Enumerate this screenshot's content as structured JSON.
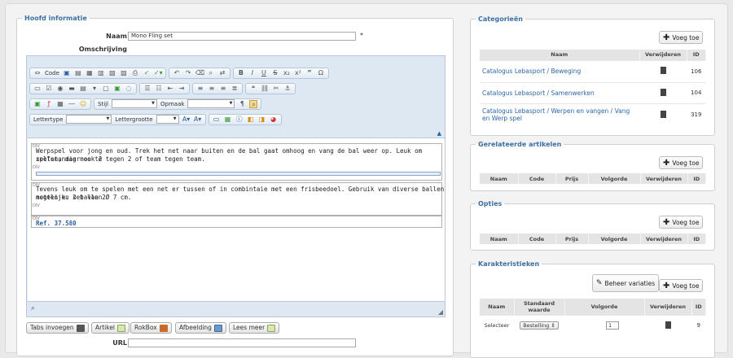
{
  "main": {
    "legend": "Hoofd informatie",
    "naam_label": "Naam",
    "naam_value": "Mono Fling set",
    "required_mark": "*",
    "omschrijving_label": "Omschrijving",
    "url_label": "URL"
  },
  "editor": {
    "code_label": "Code",
    "stijl_label": "Stijl",
    "opmaak_label": "Opmaak",
    "lettertype_label": "Lettertype",
    "lettergrootte_label": "Lettergrootte",
    "div_tag": "DIV",
    "para1": [
      "Werpspel voor jong en oud. Trek het net naar buiten en de bal gaat omhoog en vang de bal weer op. Leuk om zelfstandig mee te",
      "spelen, maar ook 2 tegen 2 of team tegen team."
    ],
    "para2": [
      "Tevens leuk om te spelen met een net er tussen of in combintaie met een frisbeedoel. Gebruik van diverse ballen mogelijk. set van 2",
      "netten en 2 ballen Ø 7 cm."
    ],
    "ref": "Ref. 37.580"
  },
  "plugin_buttons": [
    "Tabs invoegen",
    "Artikel",
    "RokBox",
    "Afbeelding",
    "Lees meer"
  ],
  "categories": {
    "legend": "Categorieën",
    "add_label": "Voeg toe",
    "col_naam": "Naam",
    "col_verwijderen": "Verwijderen",
    "col_id": "ID",
    "rows": [
      {
        "name": "Catalogus Lebasport / Beweging",
        "id": "106"
      },
      {
        "name": "Catalogus Lebasport / Samenwerken",
        "id": "104"
      },
      {
        "name": "Catalogus Lebasport / Werpen en vangen / Vang en Werp spel",
        "id": "319"
      }
    ]
  },
  "related": {
    "legend": "Gerelateerde artikelen",
    "add_label": "Voeg toe",
    "columns": [
      "Naam",
      "Code",
      "Prijs",
      "Volgorde",
      "Verwijderen",
      "ID"
    ]
  },
  "options": {
    "legend": "Opties",
    "add_label": "Voeg toe",
    "columns": [
      "Naam",
      "Code",
      "Prijs",
      "Volgorde",
      "Verwijderen",
      "ID"
    ]
  },
  "characteristics": {
    "legend": "Karakteristieken",
    "manage_label": "Beheer variaties",
    "add_label": "Voeg toe",
    "columns": [
      "Naam",
      "Standaard waarde",
      "Volgorde",
      "Verwijderen",
      "ID"
    ],
    "row": {
      "name": "Selecteer",
      "default": "Bestelling",
      "order": "1",
      "id": "9"
    }
  }
}
